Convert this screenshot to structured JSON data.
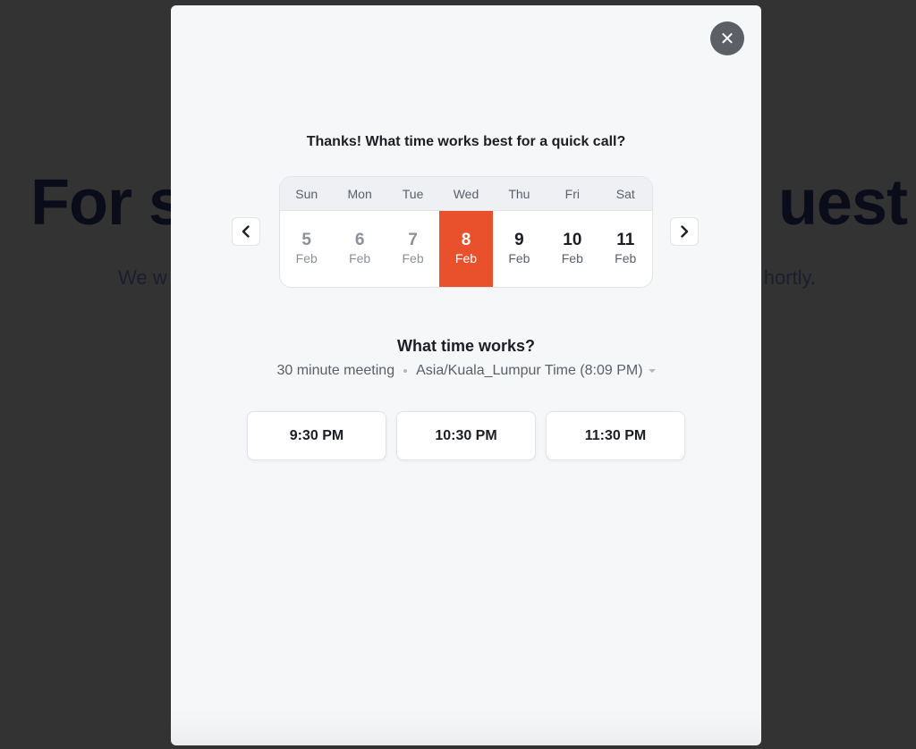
{
  "background": {
    "heading_left": "For s",
    "heading_right": "uest",
    "sub_left": "We w",
    "sub_right": "hortly."
  },
  "modal": {
    "close_icon": "close-icon",
    "title": "Thanks! What time works best for a quick call?",
    "calendar": {
      "prev_icon": "chevron-left-icon",
      "next_icon": "chevron-right-icon",
      "days": [
        {
          "name": "Sun",
          "date": "5",
          "month": "Feb",
          "state": "past"
        },
        {
          "name": "Mon",
          "date": "6",
          "month": "Feb",
          "state": "past"
        },
        {
          "name": "Tue",
          "date": "7",
          "month": "Feb",
          "state": "past"
        },
        {
          "name": "Wed",
          "date": "8",
          "month": "Feb",
          "state": "selected"
        },
        {
          "name": "Thu",
          "date": "9",
          "month": "Feb",
          "state": "future"
        },
        {
          "name": "Fri",
          "date": "10",
          "month": "Feb",
          "state": "future"
        },
        {
          "name": "Sat",
          "date": "11",
          "month": "Feb",
          "state": "future"
        }
      ],
      "selected_color": "#e8512c"
    },
    "section_title": "What time works?",
    "meeting_length": "30 minute meeting",
    "timezone": "Asia/Kuala_Lumpur Time (8:09 PM)",
    "slots": [
      "9:30 PM",
      "10:30 PM",
      "11:30 PM"
    ]
  }
}
